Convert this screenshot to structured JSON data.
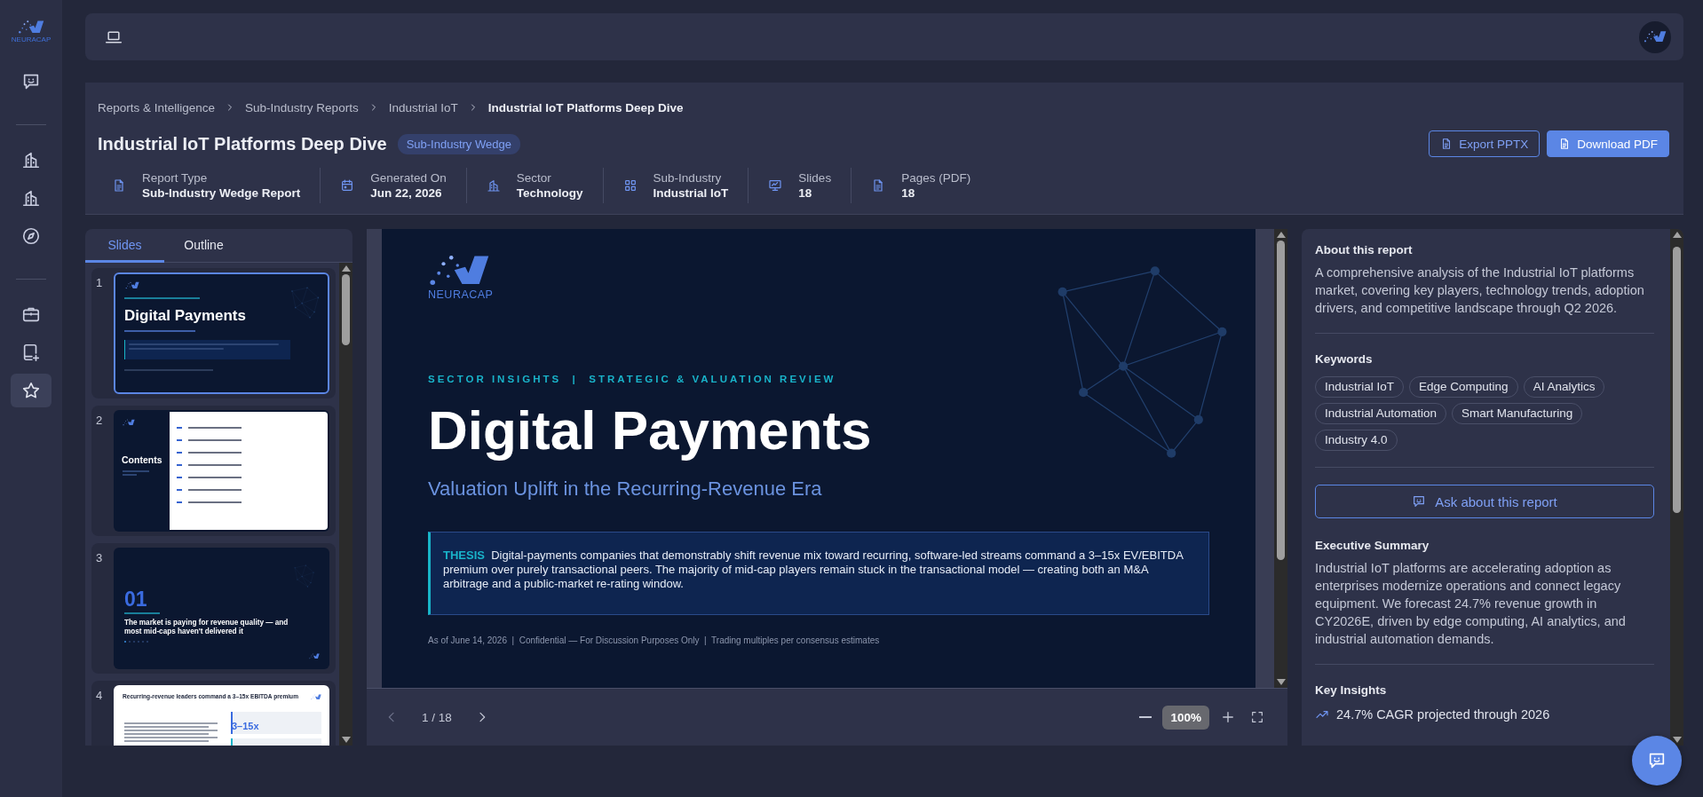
{
  "sidebar": {
    "brand": "NEURACAP",
    "groups": [
      {
        "items": [
          {
            "kind": "chat",
            "selected": false
          }
        ]
      },
      {
        "items": [
          {
            "kind": "building",
            "selected": false
          },
          {
            "kind": "building",
            "selected": false
          },
          {
            "kind": "compass",
            "selected": false
          }
        ]
      },
      {
        "items": [
          {
            "kind": "briefcase",
            "selected": false
          },
          {
            "kind": "tablet-plus",
            "selected": false
          },
          {
            "kind": "star",
            "selected": true
          }
        ]
      }
    ]
  },
  "breadcrumb": [
    {
      "label": "Reports & Intelligence",
      "current": false
    },
    {
      "label": "Sub-Industry Reports",
      "current": false
    },
    {
      "label": "Industrial IoT",
      "current": false
    },
    {
      "label": "Industrial IoT Platforms Deep Dive",
      "current": true
    }
  ],
  "title": "Industrial IoT Platforms Deep Dive",
  "badge": "Sub-Industry Wedge",
  "actions": [
    {
      "label": "Export PPTX",
      "kind": "outline"
    },
    {
      "label": "Download PDF",
      "kind": "primary"
    }
  ],
  "meta": [
    {
      "kind": "document",
      "label": "Report Type",
      "value": "Sub-Industry Wedge Report"
    },
    {
      "kind": "calendar",
      "label": "Generated On",
      "value": "Jun 22, 2026"
    },
    {
      "kind": "building",
      "label": "Sector",
      "value": "Technology"
    },
    {
      "kind": "grid",
      "label": "Sub-Industry",
      "value": "Industrial IoT"
    },
    {
      "kind": "presentation",
      "label": "Slides",
      "value": "18"
    },
    {
      "kind": "document",
      "label": "Pages (PDF)",
      "value": "18"
    }
  ],
  "slides_panel": {
    "tabs": [
      {
        "label": "Slides",
        "selected": true
      },
      {
        "label": "Outline",
        "selected": false
      }
    ],
    "thumbnails": [
      {
        "number": "1",
        "selected": true,
        "kind": "title",
        "heading": "Digital Payments"
      },
      {
        "number": "2",
        "selected": false,
        "kind": "contents",
        "heading": "Contents"
      },
      {
        "number": "3",
        "selected": false,
        "kind": "section",
        "section": "01",
        "heading": "The market is paying for revenue quality — and most mid-caps haven't delivered it"
      },
      {
        "number": "4",
        "selected": false,
        "kind": "kpi",
        "heading": "Recurring-revenue leaders command a 3–15x EBITDA premium",
        "figure": "3–15x"
      }
    ]
  },
  "viewer": {
    "slide": {
      "brand": "NEURACAP",
      "eyebrow": "SECTOR INSIGHTS  |  STRATEGIC & VALUATION REVIEW",
      "title": "Digital Payments",
      "subtitle": "Valuation Uplift in the Recurring-Revenue Era",
      "thesis": "**THESIS**  Digital-payments companies that demonstrably shift revenue mix toward recurring, software-led streams command a 3–15x EV/EBITDA premium over purely transactional peers. The majority of mid-cap players remain stuck in the transactional model — creating both an M&A arbitrage and a public-market re-rating window.",
      "footer": "As of June 14, 2026  |  Confidential — For Discussion Purposes Only  |  Trading multiples per consensus estimates"
    },
    "page": "1 / 18",
    "zoom": "100%"
  },
  "details": {
    "about": {
      "heading": "About this report",
      "text": "A comprehensive analysis of the Industrial IoT platforms market, covering key players, technology trends, adoption drivers, and competitive landscape through Q2 2026."
    },
    "keywords": {
      "heading": "Keywords",
      "tags": [
        "Industrial IoT",
        "Edge Computing",
        "AI Analytics",
        "Industrial Automation",
        "Smart Manufacturing",
        "Industry 4.0"
      ]
    },
    "ask_button": "Ask about this report",
    "summary": {
      "heading": "Executive Summary",
      "text": "Industrial IoT platforms are accelerating adoption as enterprises modernize operations and connect legacy equipment. We forecast 24.7% revenue growth in CY2026E, driven by edge computing, AI analytics, and industrial automation demands."
    },
    "insights": {
      "heading": "Key Insights",
      "items": [
        {
          "text": "24.7% CAGR projected through 2026"
        }
      ]
    }
  }
}
